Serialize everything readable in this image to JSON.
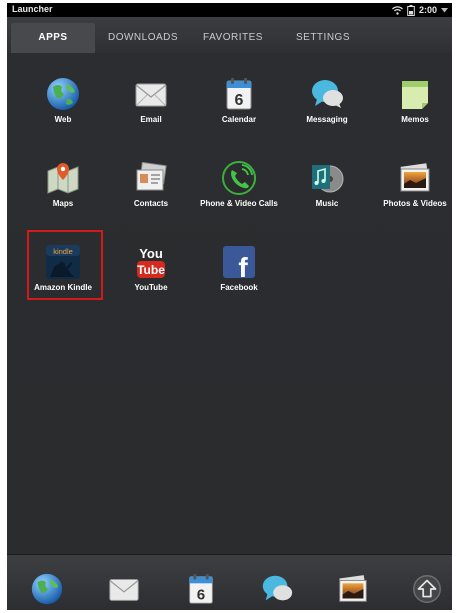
{
  "statusbar": {
    "title": "Launcher",
    "time": "2:00",
    "icons": [
      "wifi-icon",
      "battery-icon",
      "dropdown-arrow-icon"
    ]
  },
  "tabs": [
    {
      "label": "APPS",
      "active": true
    },
    {
      "label": "DOWNLOADS",
      "active": false
    },
    {
      "label": "FAVORITES",
      "active": false
    },
    {
      "label": "SETTINGS",
      "active": false
    }
  ],
  "apps": [
    {
      "label": "Web",
      "icon": "globe-icon"
    },
    {
      "label": "Email",
      "icon": "envelope-icon"
    },
    {
      "label": "Calendar",
      "icon": "calendar-icon",
      "calendar_day": "6"
    },
    {
      "label": "Messaging",
      "icon": "chat-bubble-icon"
    },
    {
      "label": "Memos",
      "icon": "memo-icon"
    },
    {
      "label": "Maps",
      "icon": "map-pin-icon"
    },
    {
      "label": "Contacts",
      "icon": "contact-cards-icon"
    },
    {
      "label": "Phone & Video Calls",
      "icon": "phone-icon"
    },
    {
      "label": "Music",
      "icon": "music-note-icon"
    },
    {
      "label": "Photos & Videos",
      "icon": "photo-stack-icon"
    },
    {
      "label": "Amazon Kindle",
      "icon": "kindle-icon",
      "icon_text": "kindle",
      "highlighted": true
    },
    {
      "label": "YouTube",
      "icon": "youtube-icon",
      "icon_text_top": "You",
      "icon_text_bottom": "Tube"
    },
    {
      "label": "Facebook",
      "icon": "facebook-icon",
      "icon_text": "f"
    }
  ],
  "dock": [
    {
      "icon": "globe-icon"
    },
    {
      "icon": "envelope-icon"
    },
    {
      "icon": "calendar-icon",
      "calendar_day": "6"
    },
    {
      "icon": "chat-bubble-icon"
    },
    {
      "icon": "photo-stack-icon"
    },
    {
      "icon": "launcher-up-arrow-icon"
    }
  ],
  "colors": {
    "background": "#2a2c2e",
    "highlight_border": "#d11a1a",
    "youtube_red": "#d42a20",
    "facebook_blue": "#3b5998"
  }
}
